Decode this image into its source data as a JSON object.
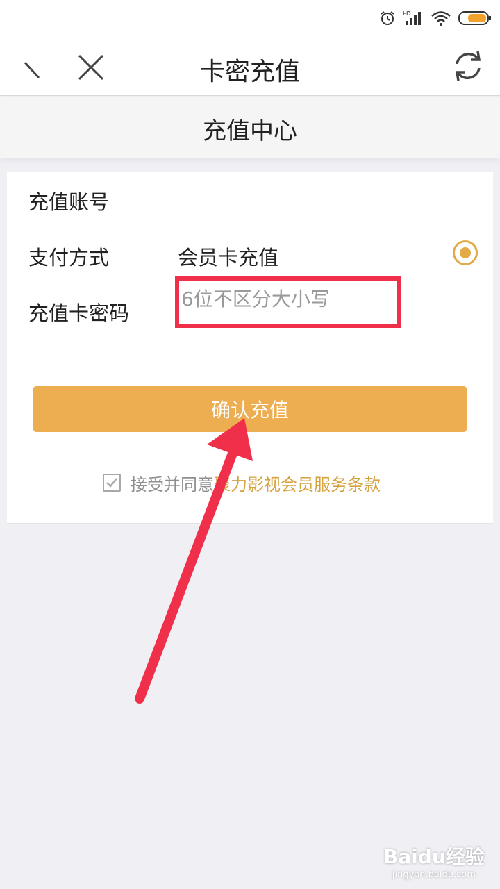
{
  "nav": {
    "title": "卡密充值"
  },
  "section": {
    "title": "充值中心"
  },
  "form": {
    "account_label": "充值账号",
    "payment_label": "支付方式",
    "payment_value": "会员卡充值",
    "pin_label": "充值卡密码",
    "pin_placeholder": "6位不区分大小写",
    "pin_value": ""
  },
  "confirm_label": "确认充值",
  "agreement": {
    "checked": true,
    "text": "接受并同意",
    "link": "聚力影视会员服务条款"
  },
  "watermark": {
    "brand": "Baidu经验",
    "url": "jingyan.baidu.com"
  },
  "colors": {
    "accent": "#edae52",
    "annotation": "#f0304a"
  },
  "icons": [
    "alarm-icon",
    "signal-icon",
    "wifi-icon",
    "battery-icon",
    "back-icon",
    "close-icon",
    "refresh-icon",
    "check-icon"
  ]
}
